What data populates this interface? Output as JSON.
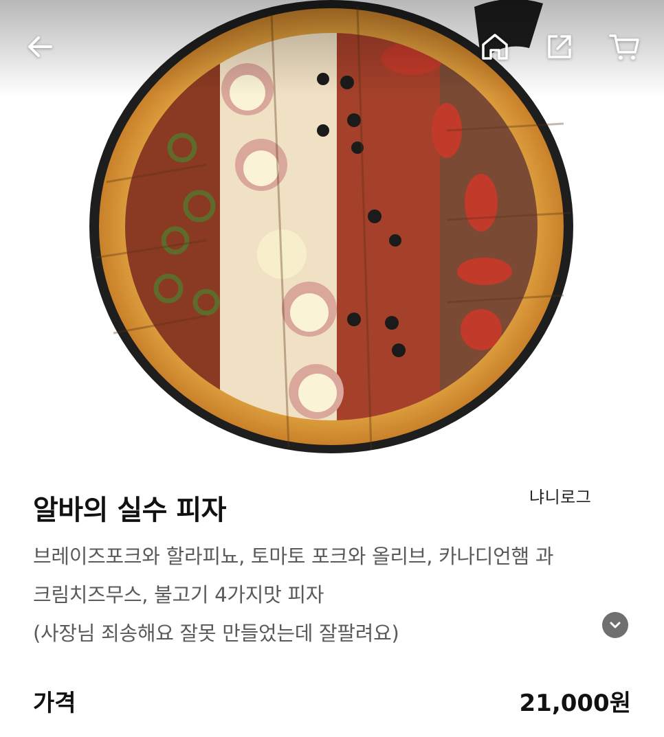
{
  "product": {
    "image_alt": "pizza-photo",
    "brand": "냐니로그",
    "title": "알바의 실수 피자",
    "description_lines": [
      "브레이즈포크와 할라피뇨, 토마토 포크와 올리브, 카나디언햄 과",
      "크림치즈무스, 불고기 4가지맛 피자",
      "(사장님 죄송해요 잘못 만들었는데 잘팔려요)"
    ],
    "price_label": "가격",
    "price_value": "21,000원"
  },
  "header": {
    "icons": [
      "arrow-left-icon",
      "home-icon",
      "share-icon",
      "cart-icon"
    ]
  }
}
